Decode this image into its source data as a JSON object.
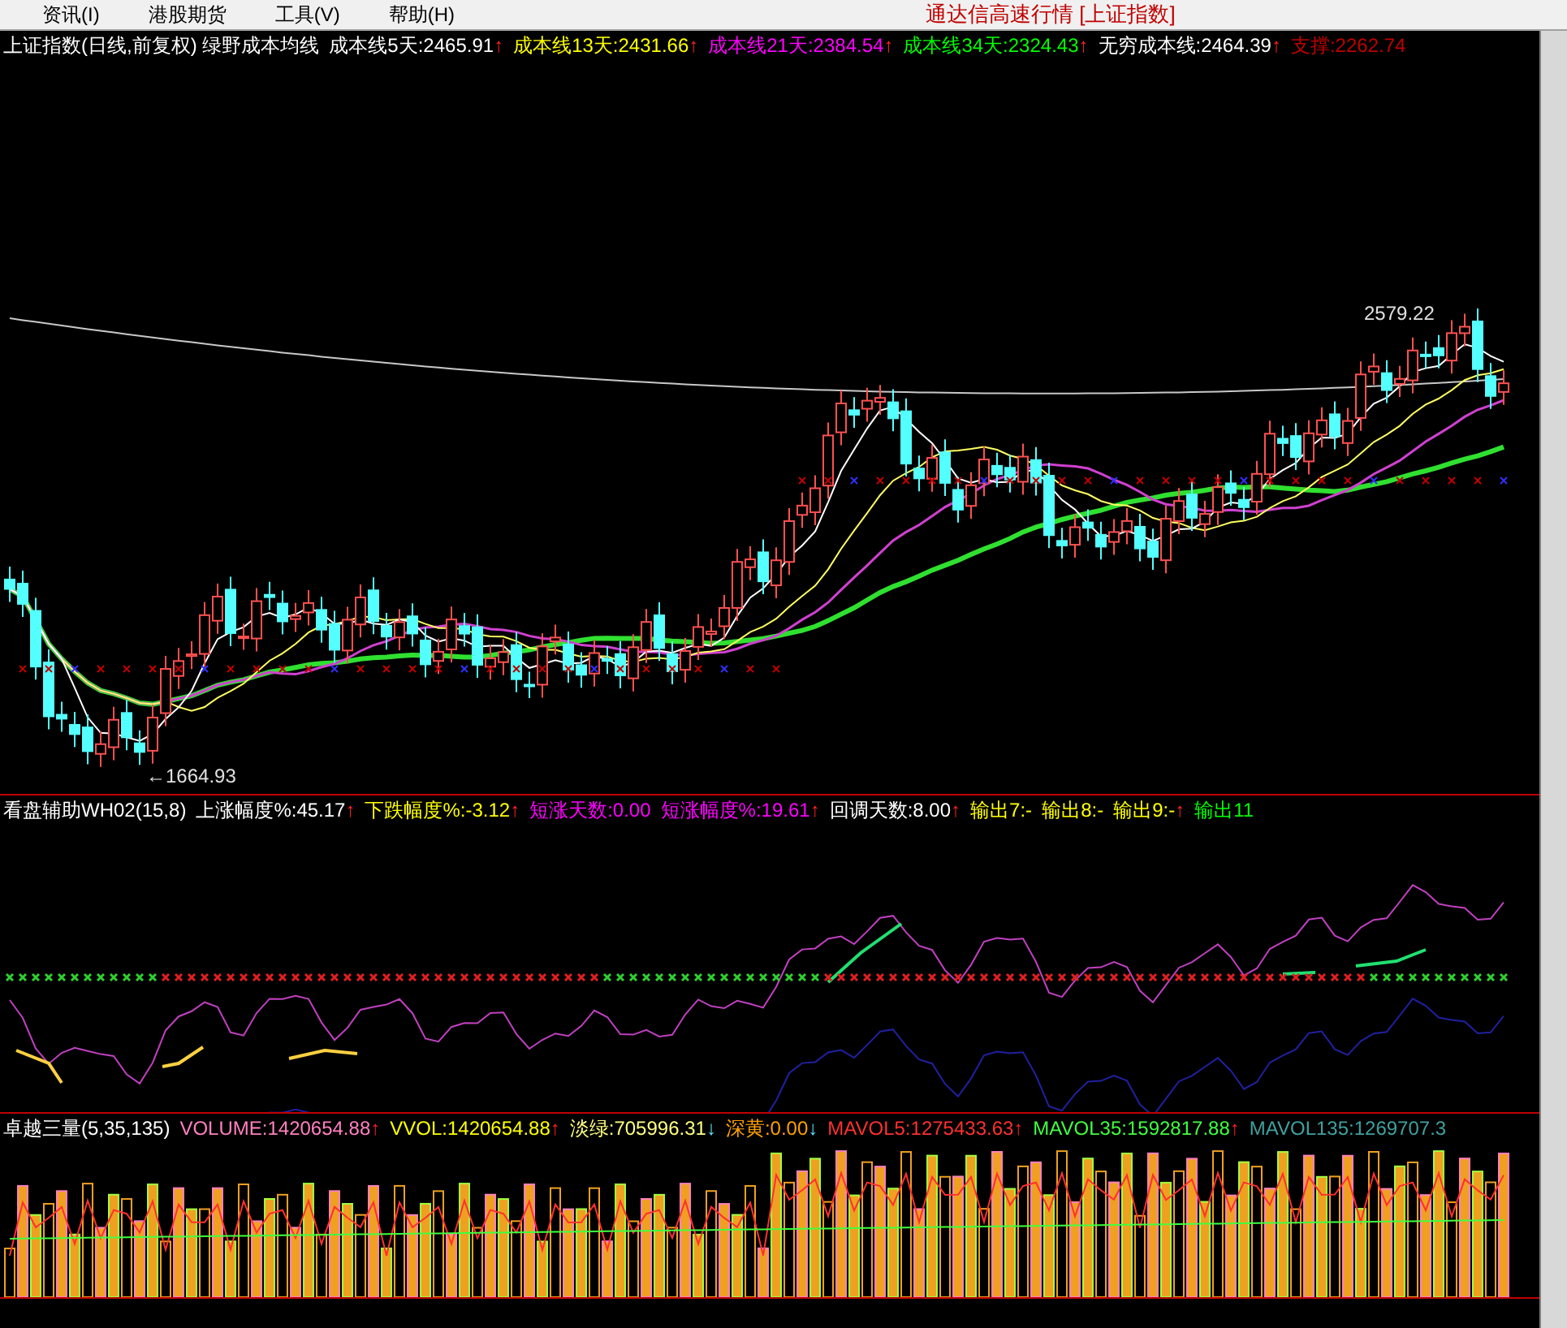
{
  "menu": {
    "items": [
      {
        "label": "资讯(I)"
      },
      {
        "label": "港股期货"
      },
      {
        "label": "工具(V)"
      },
      {
        "label": "帮助(H)"
      }
    ],
    "title": "通达信高速行情 [上证指数]"
  },
  "main_panel": {
    "legend": [
      {
        "text": "上证指数(日线,前复权) 绿野成本均线",
        "color": "#ffffff"
      },
      {
        "text": "成本线5天:2465.91",
        "color": "#ffffff",
        "arrow": "↑"
      },
      {
        "text": "成本线13天:2431.66",
        "color": "#ffff00",
        "arrow": "↑"
      },
      {
        "text": "成本线21天:2384.54",
        "color": "#ff00ff",
        "arrow": "↑"
      },
      {
        "text": "成本线34天:2324.43",
        "color": "#00ff00",
        "arrow": "↑"
      },
      {
        "text": "无穷成本线:2464.39",
        "color": "#ffffff",
        "arrow": "↑"
      },
      {
        "text": "支撑:2262.74",
        "color": "#c00000"
      }
    ],
    "high_label": "2579.22",
    "low_label": "←1664.93"
  },
  "indicator_panel": {
    "legend": [
      {
        "text": "看盘辅助WH02(15,8)",
        "color": "#ffffff"
      },
      {
        "text": "上涨幅度%:45.17",
        "color": "#ffffff",
        "arrow": "↑"
      },
      {
        "text": "下跌幅度%:-3.12",
        "color": "#ffff00",
        "arrow": "↑"
      },
      {
        "text": "短涨天数:0.00",
        "color": "#ff00ff"
      },
      {
        "text": "短涨幅度%:19.61",
        "color": "#ff00ff",
        "arrow": "↑"
      },
      {
        "text": "回调天数:8.00",
        "color": "#ffffff",
        "arrow": "↑"
      },
      {
        "text": "输出7:-",
        "color": "#ffff00"
      },
      {
        "text": "输出8:-",
        "color": "#ffff00"
      },
      {
        "text": "输出9:-",
        "color": "#ffff00",
        "arrow": "↑"
      },
      {
        "text": "输出11",
        "color": "#00ff00"
      }
    ]
  },
  "volume_panel": {
    "legend": [
      {
        "text": "卓越三量(5,35,135)",
        "color": "#ffffff"
      },
      {
        "text": "VOLUME:1420654.88",
        "color": "#ff80c0",
        "arrow": "↑"
      },
      {
        "text": "VVOL:1420654.88",
        "color": "#ffff00",
        "arrow": "↑"
      },
      {
        "text": "淡绿:705996.31",
        "color": "#ffff80",
        "arrow": "↓"
      },
      {
        "text": "深黄:0.00",
        "color": "#ffa000",
        "arrow": "↓"
      },
      {
        "text": "MAVOL5:1275433.63",
        "color": "#ff3030",
        "arrow": "↑"
      },
      {
        "text": "MAVOL35:1592817.88",
        "color": "#40ff40",
        "arrow": "↑"
      },
      {
        "text": "MAVOL135:1269707.3",
        "color": "#40a0a0"
      }
    ]
  }
}
